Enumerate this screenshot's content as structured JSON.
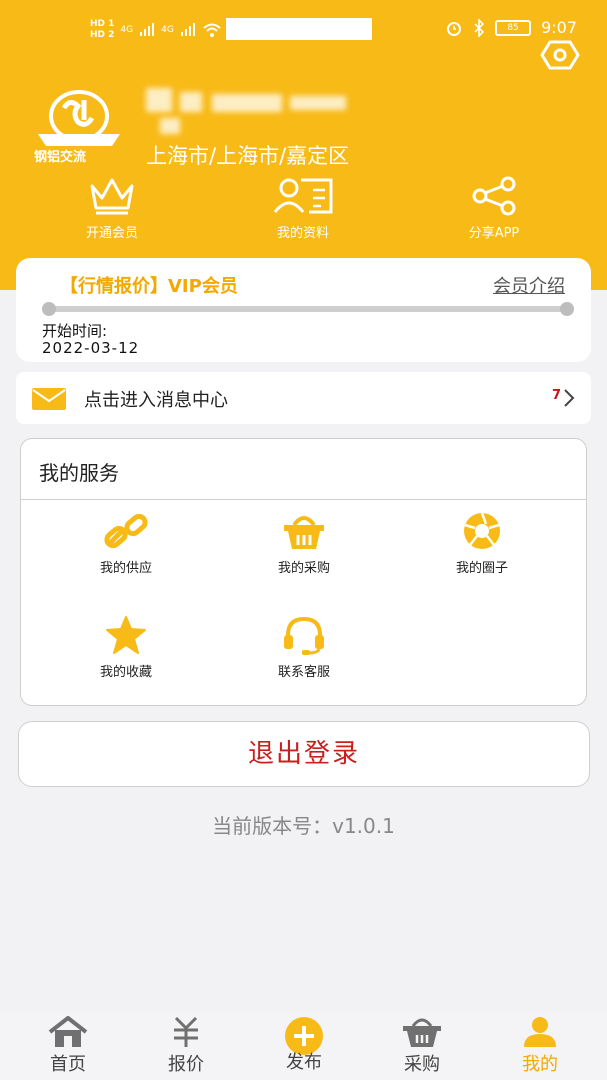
{
  "status_bar": {
    "hd1": "HD 1",
    "hd2": "HD 2",
    "signal1": "4G",
    "signal2": "4G",
    "battery": "85",
    "time": "9:07"
  },
  "profile": {
    "logo_text": "钢铝交流",
    "location": "上海市/上海市/嘉定区"
  },
  "quick_actions": [
    {
      "label": "开通会员",
      "icon": "crown-icon"
    },
    {
      "label": "我的资料",
      "icon": "profile-card-icon"
    },
    {
      "label": "分享APP",
      "icon": "share-icon"
    }
  ],
  "vip": {
    "title": "【行情报价】VIP会员",
    "intro_link": "会员介绍",
    "start_label": "开始时间:",
    "start_date": "2022-03-12",
    "progress": 0
  },
  "message_center": {
    "label": "点击进入消息中心",
    "count": "7"
  },
  "services": {
    "title": "我的服务",
    "items": [
      {
        "label": "我的供应",
        "icon": "link-icon"
      },
      {
        "label": "我的采购",
        "icon": "basket-icon"
      },
      {
        "label": "我的圈子",
        "icon": "aperture-icon"
      },
      {
        "label": "我的收藏",
        "icon": "star-icon"
      },
      {
        "label": "联系客服",
        "icon": "headset-icon"
      }
    ]
  },
  "logout_label": "退出登录",
  "version_text": "当前版本号：v1.0.1",
  "tabs": [
    {
      "label": "首页",
      "icon": "home-icon"
    },
    {
      "label": "报价",
      "icon": "yuan-icon"
    },
    {
      "label": "发布",
      "icon": "plus-circle-icon"
    },
    {
      "label": "采购",
      "icon": "basket-icon"
    },
    {
      "label": "我的",
      "icon": "user-icon",
      "active": true
    }
  ],
  "colors": {
    "brand": "#f8ba16",
    "accent_text": "#f2a900",
    "danger": "#c8201d",
    "background": "#f2f2f4"
  }
}
